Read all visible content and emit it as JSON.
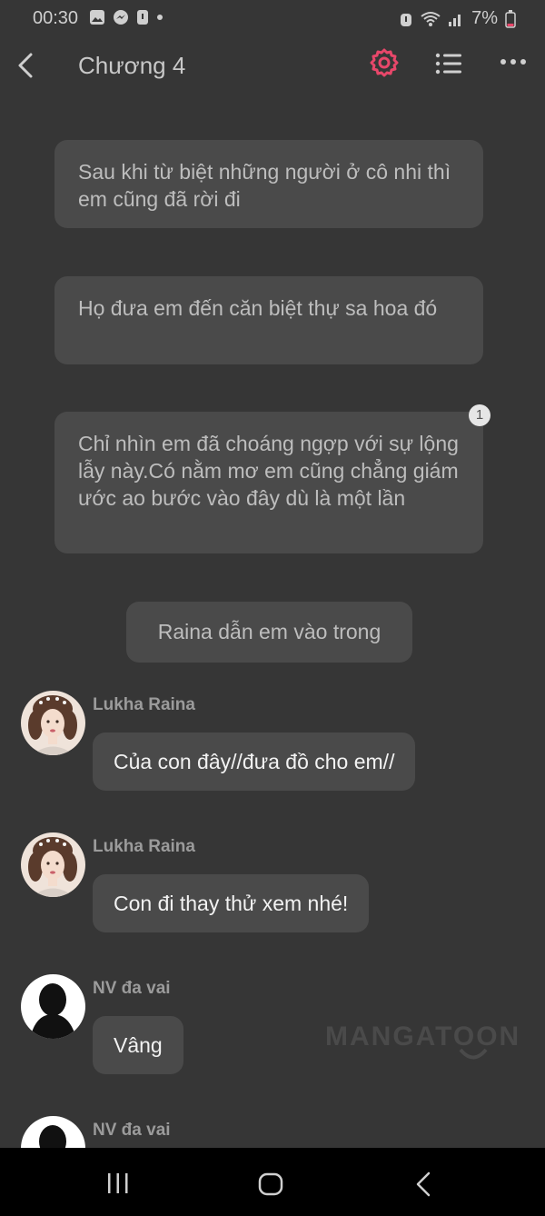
{
  "status_bar": {
    "time": "00:30",
    "left_icons": [
      "gallery-icon",
      "messenger-icon",
      "security-icon",
      "dot-icon"
    ],
    "battery": "7%",
    "right_icons": [
      "alarm-icon",
      "wifi-icon",
      "signal-icon",
      "battery-low-icon"
    ]
  },
  "app_bar": {
    "title": "Chương 4",
    "accent_color": "#e8476a"
  },
  "narrations": [
    {
      "text": "Sau khi từ biệt những người ở cô nhi thì em cũng đã rời đi"
    },
    {
      "text": "Họ đưa em đến căn biệt thự sa hoa đó"
    },
    {
      "text": "Chỉ nhìn em đã choáng ngợp với sự lộng lẫy này.Có nằm mơ em cũng chẳng giám ước ao bước vào đây dù là một lần",
      "badge": "1"
    }
  ],
  "scene_line": "Raina dẫn em vào trong",
  "messages": [
    {
      "sender": "Lukha Raina",
      "text": "Của con đây//đưa đồ cho em//"
    },
    {
      "sender": "Lukha Raina",
      "text": "Con đi thay thử xem nhé!"
    },
    {
      "sender": "NV đa vai",
      "text": "Vâng"
    },
    {
      "sender": "NV đa vai"
    }
  ],
  "watermark": "MANGATOON"
}
